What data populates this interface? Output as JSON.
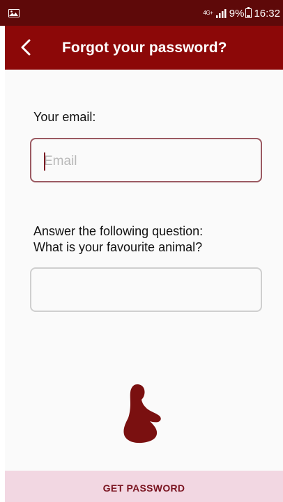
{
  "status_bar": {
    "network": "4G+",
    "battery_percent": "9%",
    "time": "16:32"
  },
  "app_bar": {
    "title": "Forgot your password?",
    "back_icon": "chevron-left-icon"
  },
  "form": {
    "email_label": "Your email:",
    "email_placeholder": "Email",
    "email_value": "",
    "question_label": "Answer the following question:",
    "question_text": "What is your favourite animal?",
    "answer_value": ""
  },
  "logo_icon": "pregnant-woman-silhouette-icon",
  "actions": {
    "submit_label": "GET PASSWORD"
  },
  "colors": {
    "status_bar": "#5e0909",
    "app_bar": "#8c0808",
    "accent": "#9b5a62",
    "logo": "#7a1010",
    "button_bg": "#f2d7e2",
    "button_text": "#7a1420"
  }
}
